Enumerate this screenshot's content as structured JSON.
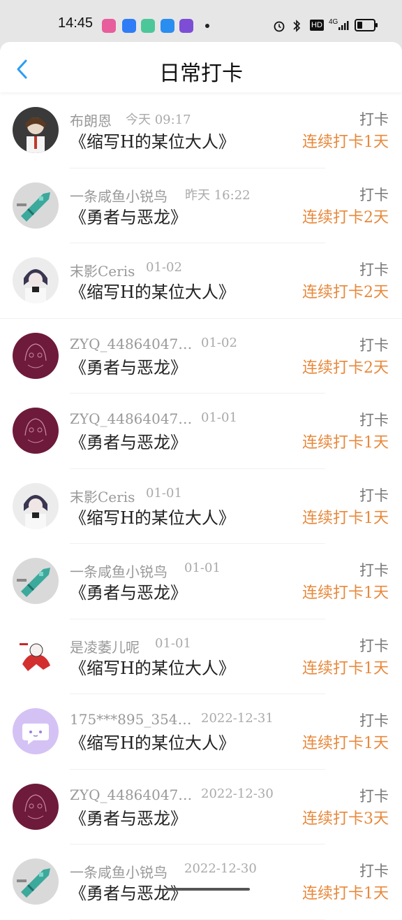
{
  "status_bar": {
    "time": "14:45",
    "right_text": "HD",
    "signal_text": "4G"
  },
  "header": {
    "title": "日常打卡"
  },
  "items": [
    {
      "user": "布朗恩",
      "time": "今天 09:17",
      "book": "《缩写H的某位大人》",
      "action": "打卡",
      "streak": "连续打卡1天",
      "avatar": "dark"
    },
    {
      "user": "一条咸鱼小锐鸟",
      "time": "昨天 16:22",
      "book": "《勇者与恶龙》",
      "action": "打卡",
      "streak": "连续打卡2天",
      "avatar": "fish"
    },
    {
      "user": "末影Ceris",
      "time": "01-02",
      "book": "《缩写H的某位大人》",
      "action": "打卡",
      "streak": "连续打卡2天",
      "avatar": "anime"
    },
    {
      "user": "ZYQ_44864047…",
      "time": "01-02",
      "book": "《勇者与恶龙》",
      "action": "打卡",
      "streak": "连续打卡2天",
      "avatar": "maroon"
    },
    {
      "user": "ZYQ_44864047…",
      "time": "01-01",
      "book": "《勇者与恶龙》",
      "action": "打卡",
      "streak": "连续打卡1天",
      "avatar": "maroon"
    },
    {
      "user": "末影Ceris",
      "time": "01-01",
      "book": "《缩写H的某位大人》",
      "action": "打卡",
      "streak": "连续打卡1天",
      "avatar": "anime"
    },
    {
      "user": "一条咸鱼小锐鸟",
      "time": "01-01",
      "book": "《勇者与恶龙》",
      "action": "打卡",
      "streak": "连续打卡1天",
      "avatar": "fish"
    },
    {
      "user": "是凌萎儿呢",
      "time": "01-01",
      "book": "《缩写H的某位大人》",
      "action": "打卡",
      "streak": "连续打卡1天",
      "avatar": "red"
    },
    {
      "user": "175***895_354…",
      "time": "2022-12-31",
      "book": "《缩写H的某位大人》",
      "action": "打卡",
      "streak": "连续打卡1天",
      "avatar": "purple"
    },
    {
      "user": "ZYQ_44864047…",
      "time": "2022-12-30",
      "book": "《勇者与恶龙》",
      "action": "打卡",
      "streak": "连续打卡3天",
      "avatar": "maroon"
    },
    {
      "user": "一条咸鱼小锐鸟",
      "time": "2022-12-30",
      "book": "《勇者与恶龙》",
      "action": "打卡",
      "streak": "连续打卡1天",
      "avatar": "fish"
    }
  ],
  "colors": {
    "accent_orange": "#e8883a",
    "back_blue": "#2a9df4",
    "maroon_avatar": "#6e1a3a",
    "purple_avatar": "#d4c2f5"
  }
}
